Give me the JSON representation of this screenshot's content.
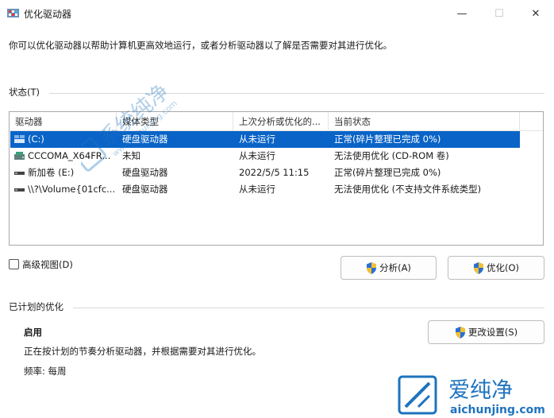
{
  "window": {
    "title": "优化驱动器",
    "minimize_glyph": "—",
    "maximize_glyph": "☐",
    "close_glyph": "✕"
  },
  "intro_text": "你可以优化驱动器以帮助计算机更高效地运行，或者分析驱动器以了解是否需要对其进行优化。",
  "status_section": {
    "label": "状态(T)"
  },
  "table": {
    "columns": [
      "驱动器",
      "媒体类型",
      "上次分析或优化的...",
      "当前状态"
    ],
    "rows": [
      {
        "icon": "system-drive-icon",
        "drive": "(C:)",
        "media": "硬盘驱动器",
        "last": "从未运行",
        "status": "正常(碎片整理已完成 0%)",
        "selected": true
      },
      {
        "icon": "cdrom-drive-icon",
        "drive": "CCCOMA_X64FR...",
        "media": "未知",
        "last": "从未运行",
        "status": "无法使用优化 (CD-ROM 卷)",
        "selected": false
      },
      {
        "icon": "hard-drive-icon",
        "drive": "新加卷 (E:)",
        "media": "硬盘驱动器",
        "last": "2022/5/5 11:15",
        "status": "正常(碎片整理已完成 0%)",
        "selected": false
      },
      {
        "icon": "hard-drive-icon",
        "drive": "\\\\?\\Volume{01cfc...",
        "media": "硬盘驱动器",
        "last": "从未运行",
        "status": "无法使用优化 (不支持文件系统类型)",
        "selected": false
      }
    ]
  },
  "advanced_view": {
    "label": "高级视图(D)",
    "checked": false
  },
  "buttons": {
    "analyze": "分析(A)",
    "optimize": "优化(O)",
    "change_settings": "更改设置(S)"
  },
  "scheduled": {
    "label": "已计划的优化",
    "status": "启用",
    "description": "正在按计划的节奏分析驱动器，并根据需要对其进行优化。",
    "frequency": "频率: 每周"
  },
  "watermark": {
    "diag_brand": "系统纯净",
    "diag_url": "www.aichunjing.com",
    "corner_brand": "爱纯净",
    "corner_url": "aichunjing.com"
  },
  "colors": {
    "selection": "#0a64c7",
    "shield_blue": "#2a6fd6",
    "shield_yellow": "#f2c12e",
    "watermark": "#1e73be"
  }
}
